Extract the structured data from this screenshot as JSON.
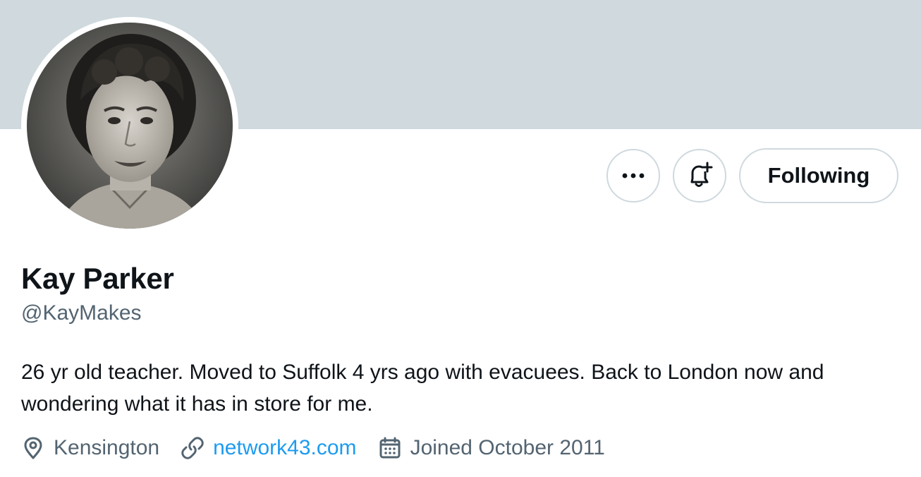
{
  "profile": {
    "display_name": "Kay Parker",
    "handle": "@KayMakes",
    "bio": "26 yr old teacher. Moved to Suffolk 4 yrs ago with evacuees. Back to London now and wondering what it has in store for me.",
    "location": "Kensington",
    "website": "network43.com",
    "joined": "Joined October 2011"
  },
  "actions": {
    "more_label": "•••",
    "follow_label": "Following"
  },
  "icons": {
    "more": "more-icon",
    "notify": "bell-plus-icon",
    "location": "location-pin-icon",
    "link": "link-icon",
    "calendar": "calendar-icon"
  },
  "colors": {
    "banner": "#cfd9de",
    "link": "#1d9bf0",
    "secondary_text": "#536471",
    "primary_text": "#0f1419",
    "button_border": "#cfd9de"
  }
}
